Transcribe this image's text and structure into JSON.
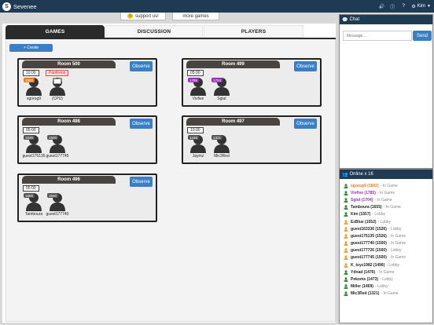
{
  "app": {
    "brand": "Sevenee",
    "user": "Kim"
  },
  "promo": {
    "support_label": "support us!",
    "more_games_label": "more games"
  },
  "tabs": [
    {
      "label": "GAMES"
    },
    {
      "label": "DISCUSSION"
    },
    {
      "label": "PLAYERS"
    }
  ],
  "create_label": "+ Create",
  "observe_label": "Observe",
  "rooms": [
    {
      "title": "Room 500",
      "timer": "10:00",
      "variant": "Pantheon",
      "players": [
        {
          "name": "sgorog9",
          "rating": "1802",
          "rating_color": "#e67e22"
        },
        {
          "name": "(CPU)",
          "rating": "",
          "rating_color": ""
        }
      ]
    },
    {
      "title": "Room 499",
      "timer": "05:00",
      "variant": "",
      "players": [
        {
          "name": "Vivfive",
          "rating": "1785",
          "rating_color": "#9b30b8"
        },
        {
          "name": "Sglut",
          "rating": "1704",
          "rating_color": "#9b30b8"
        }
      ]
    },
    {
      "title": "Room 498",
      "timer": "05:00",
      "variant": "",
      "players": [
        {
          "name": "guest175135",
          "rating": "1526",
          "rating_color": "#555555"
        },
        {
          "name": "guest177745",
          "rating": "1500",
          "rating_color": "#555555"
        }
      ]
    },
    {
      "title": "Room 497",
      "timer": "10:00",
      "variant": "",
      "players": [
        {
          "name": "Jaymz",
          "rating": "1446",
          "rating_color": "#555555"
        },
        {
          "name": "Mic3Red",
          "rating": "1321",
          "rating_color": "#555555"
        }
      ]
    },
    {
      "title": "Room 496",
      "timer": "05:00",
      "variant": "",
      "players": [
        {
          "name": "Tamboura",
          "rating": "1655",
          "rating_color": "#555555"
        },
        {
          "name": "guest177740",
          "rating": "1500",
          "rating_color": "#555555"
        }
      ]
    }
  ],
  "chat": {
    "title": "Chat",
    "placeholder": "Message...",
    "send_label": "Send"
  },
  "online": {
    "title": "Online x 16",
    "users": [
      {
        "name": "sgorog9 (1802)",
        "status": "- In Game",
        "color": "#e67e22",
        "icon_color": "#3c8b3c"
      },
      {
        "name": "Vivfive (1785)",
        "status": "- In Game",
        "color": "#9b30b8",
        "icon_color": "#3c8b3c"
      },
      {
        "name": "Sglut (1704)",
        "status": "- In Game",
        "color": "#9b30b8",
        "icon_color": "#3c8b3c"
      },
      {
        "name": "Tamboura (1655)",
        "status": "- In Game",
        "color": "#222222",
        "icon_color": "#3c8b3c"
      },
      {
        "name": "Kim (1557)",
        "status": "- Lobby",
        "color": "#222222",
        "icon_color": "#3c8b3c"
      },
      {
        "name": "EzBlue (1552)",
        "status": "- Lobby",
        "color": "#222222",
        "icon_color": "#e6a23c"
      },
      {
        "name": "guest163336 (1526)",
        "status": "- Lobby",
        "color": "#222222",
        "icon_color": "#e6a23c"
      },
      {
        "name": "guest175135 (1526)",
        "status": "- In Game",
        "color": "#222222",
        "icon_color": "#e6a23c"
      },
      {
        "name": "guest177740 (1500)",
        "status": "- In Game",
        "color": "#222222",
        "icon_color": "#e6a23c"
      },
      {
        "name": "guest177726 (1500)",
        "status": "- Lobby",
        "color": "#222222",
        "icon_color": "#e6a23c"
      },
      {
        "name": "guest177745 (1500)",
        "status": "- In Game",
        "color": "#222222",
        "icon_color": "#e6a23c"
      },
      {
        "name": "K_toyz1982 (1496)",
        "status": "- Lobby",
        "color": "#222222",
        "icon_color": "#e6a23c"
      },
      {
        "name": "Ydnad (1476)",
        "status": "- In Game",
        "color": "#222222",
        "icon_color": "#3c8b3c"
      },
      {
        "name": "Pekoms (1473)",
        "status": "- Lobby",
        "color": "#222222",
        "icon_color": "#3c8b3c"
      },
      {
        "name": "Miller (1469)",
        "status": "- Lobby",
        "color": "#222222",
        "icon_color": "#3c8b3c"
      },
      {
        "name": "Mic3Red (1321)",
        "status": "- In Game",
        "color": "#222222",
        "icon_color": "#3c8b3c"
      }
    ]
  }
}
